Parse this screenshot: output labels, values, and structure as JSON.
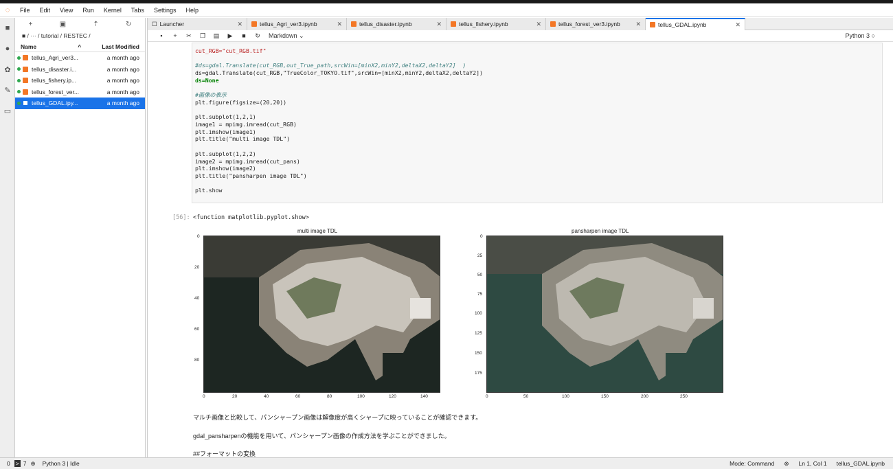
{
  "menu": [
    "File",
    "Edit",
    "View",
    "Run",
    "Kernel",
    "Tabs",
    "Settings",
    "Help"
  ],
  "filebrowser": {
    "path": "/ ··· / tutorial / RESTEC /",
    "col_name": "Name",
    "col_modified": "Last Modified",
    "files": [
      {
        "name": "tellus_Agri_ver3...",
        "modified": "a month ago",
        "running": true
      },
      {
        "name": "tellus_disaster.i...",
        "modified": "a month ago",
        "running": true
      },
      {
        "name": "tellus_fishery.ip...",
        "modified": "a month ago",
        "running": true
      },
      {
        "name": "tellus_forest_ver...",
        "modified": "a month ago",
        "running": true
      },
      {
        "name": "tellus_GDAL.ipy...",
        "modified": "a month ago",
        "running": true
      }
    ]
  },
  "tabs": [
    "Launcher",
    "tellus_Agri_ver3.ipynb",
    "tellus_disaster.ipynb",
    "tellus_fishery.ipynb",
    "tellus_forest_ver3.ipynb",
    "tellus_GDAL.ipynb"
  ],
  "toolbar": {
    "cell_type": "Markdown",
    "kernel": "Python 3"
  },
  "code": {
    "l1": "cut_RGB=\"cut_RGB.tif\"",
    "l2": "#ds=gdal.Translate(cut_RGB,out_True_path,srcWin=[minX2,minY2,deltaX2,deltaY2]  )",
    "l3": "ds=gdal.Translate(cut_RGB,\"TrueColor_TOKYO.tif\",srcWin=[minX2,minY2,deltaX2,deltaY2])",
    "l4": "ds=None",
    "l5": "#画像の表示",
    "l6": "plt.figure(figsize=(20,20))",
    "l7": "plt.subplot(1,2,1)",
    "l8": "image1 = mpimg.imread(cut_RGB)",
    "l9": "plt.imshow(image1)",
    "l10": "plt.title(\"multi image TDL\")",
    "l11": "plt.subplot(1,2,2)",
    "l12": "image2 = mpimg.imread(cut_pans)",
    "l13": "plt.imshow(image2)",
    "l14": "plt.title(\"pansharpen image TDL\")",
    "l15": "plt.show"
  },
  "output": {
    "prompt": "[56]:",
    "text": "<function matplotlib.pyplot.show>",
    "plot1_title": "multi image TDL",
    "plot2_title": "pansharpen image TDL",
    "plot1_yticks": [
      "0",
      "20",
      "40",
      "60",
      "80"
    ],
    "plot1_xticks": [
      "0",
      "20",
      "40",
      "60",
      "80",
      "100",
      "120",
      "140"
    ],
    "plot2_yticks": [
      "0",
      "25",
      "50",
      "75",
      "100",
      "125",
      "150",
      "175"
    ],
    "plot2_xticks": [
      "0",
      "50",
      "100",
      "150",
      "200",
      "250"
    ]
  },
  "markdown": {
    "p1": "マルチ画像と比較して、パンシャープン画像は解像度が高くシャープに映っていることが確認できます。",
    "p2": "gdal_pansharpenの機能を用いて、パンシャープン画像の作成方法を学ぶことができました。",
    "p3": "##フォーマットの変換"
  },
  "status": {
    "left": "0",
    "terminals": "7",
    "kernel": "Python 3 | Idle",
    "mode": "Mode: Command",
    "pos": "Ln 1, Col 1",
    "file": "tellus_GDAL.ipynb"
  }
}
